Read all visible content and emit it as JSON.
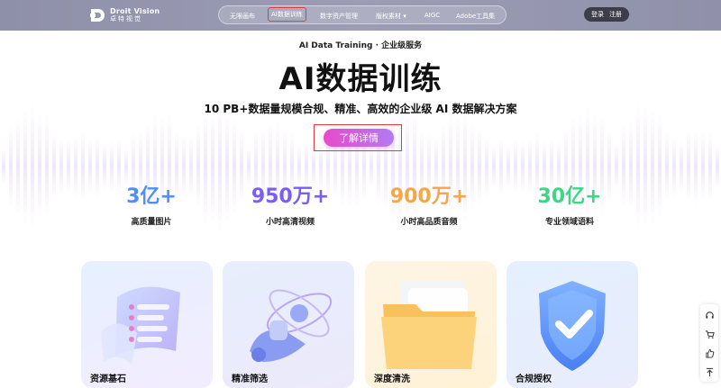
{
  "header": {
    "logo_en": "Droit Vision",
    "logo_cn": "卓特视觉",
    "nav": [
      {
        "label": "无限画布"
      },
      {
        "label": "AI数据训练"
      },
      {
        "label": "数字资产管理"
      },
      {
        "label": "版权素材 ▾"
      },
      {
        "label": "AIGC"
      },
      {
        "label": "Adobe工具集"
      }
    ],
    "login": "登录",
    "register": "注册"
  },
  "hero": {
    "subtitle": "AI Data Training · 企业级服务",
    "title": "AI数据训练",
    "description": "10 PB+数据量规模合规、精准、高效的企业级 AI 数据解决方案",
    "cta": "了解详情"
  },
  "stats": [
    {
      "value": "3亿+",
      "label": "高质量图片",
      "color": "#4f8ff7"
    },
    {
      "value": "950万+",
      "label": "小时高清视频",
      "color": "#7b5cf5"
    },
    {
      "value": "900万+",
      "label": "小时高品质音频",
      "color": "#f6a548"
    },
    {
      "value": "30亿+",
      "label": "专业领域语料",
      "color": "#3ed686"
    }
  ],
  "cards": [
    {
      "title": "资源基石"
    },
    {
      "title": "精准筛选"
    },
    {
      "title": "深度清洗"
    },
    {
      "title": "合规授权"
    }
  ],
  "sidebar": {
    "icons": [
      "headset-icon",
      "cart-icon",
      "thumb-up-icon",
      "back-to-top-icon"
    ]
  },
  "colors": {
    "header_bg": "#9c9db5",
    "cta_gradient_start": "#e84ac9",
    "cta_gradient_end": "#b07cf2",
    "highlight_border": "#e53b3b"
  }
}
